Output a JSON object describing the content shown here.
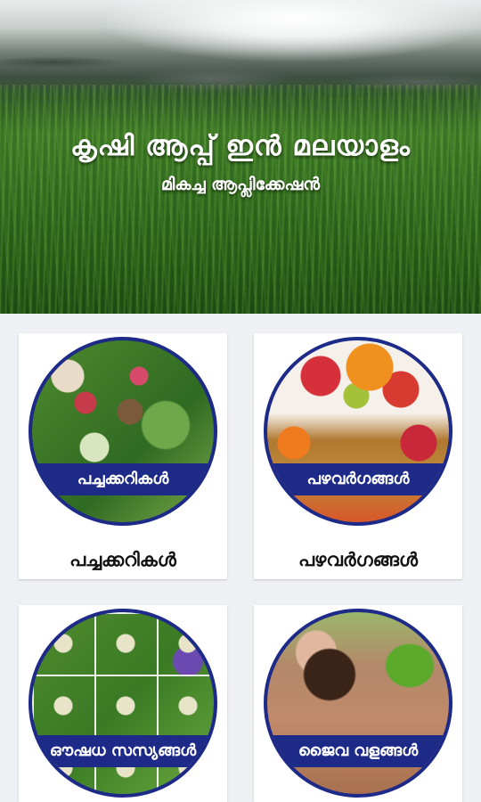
{
  "header": {
    "title": "കൃഷി ആപ്പ് ഇൻ മലയാളം",
    "subtitle": "മികച്ച ആപ്ലിക്കേഷൻ"
  },
  "categories": [
    {
      "banner": "പച്ചക്കറികൾ",
      "label": "പച്ചക്കറികൾ"
    },
    {
      "banner": "പഴവർഗങ്ങൾ",
      "label": "പഴവർഗങ്ങൾ"
    },
    {
      "banner": "ഔഷധ സസ്യങ്ങൾ"
    },
    {
      "banner": "ജൈവ വളങ്ങൾ"
    }
  ],
  "colors": {
    "accent": "#1d2a88",
    "background": "#eef0f3",
    "card": "#ffffff"
  }
}
